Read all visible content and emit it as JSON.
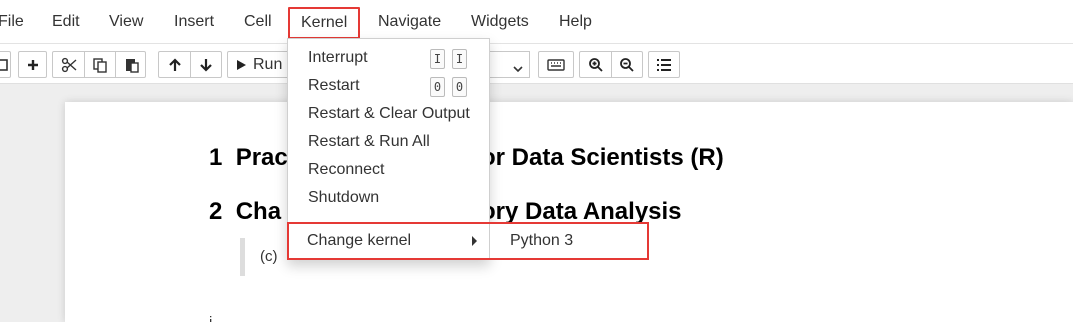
{
  "menubar": {
    "items": [
      "File",
      "Edit",
      "View",
      "Insert",
      "Cell",
      "Kernel",
      "Navigate",
      "Widgets",
      "Help"
    ]
  },
  "toolbar": {
    "run_label": "Run",
    "icons": [
      "save-icon",
      "add-icon",
      "cut-icon",
      "copy-icon",
      "paste-icon",
      "move-up-icon",
      "move-down-icon",
      "play-icon",
      "keyboard-icon",
      "zoom-in-icon",
      "zoom-out-icon",
      "list-icon"
    ]
  },
  "kernel_menu": {
    "items": [
      {
        "label": "Interrupt",
        "shortcut": [
          "I",
          "I"
        ]
      },
      {
        "label": "Restart",
        "shortcut": [
          "0",
          "0"
        ]
      },
      {
        "label": "Restart & Clear Output"
      },
      {
        "label": "Restart & Run All"
      },
      {
        "label": "Reconnect"
      },
      {
        "label": "Shutdown"
      }
    ],
    "change_kernel": "Change kernel",
    "submenu": [
      "Python 3"
    ]
  },
  "notebook": {
    "h1_num": "1",
    "h1_text": "Prac",
    "h1_tail": "or Data Scientists (R)",
    "h2_num": "2",
    "h2_text": "Cha",
    "h2_tail": "ory Data Analysis",
    "quote_text": "(c)",
    "bottom_text": "i"
  },
  "colors": {
    "highlight_border": "#e53935"
  }
}
